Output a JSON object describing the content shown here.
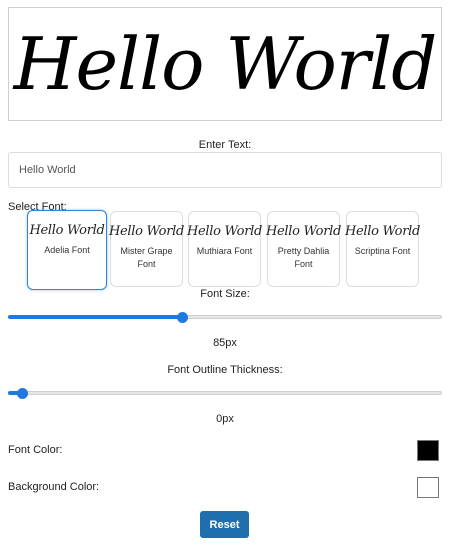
{
  "preview": {
    "text": "Hello World"
  },
  "text_input": {
    "label": "Enter Text:",
    "value": "Hello World"
  },
  "font_select": {
    "label": "Select Font:",
    "selected_index": 0,
    "options": [
      {
        "sample": "Hello World",
        "name": "Adelia Font"
      },
      {
        "sample": "Hello World",
        "name": "Mister Grape Font"
      },
      {
        "sample": "Hello World",
        "name": "Muthiara Font"
      },
      {
        "sample": "Hello World",
        "name": "Pretty Dahlia Font"
      },
      {
        "sample": "Hello World",
        "name": "Scriptina Font"
      }
    ]
  },
  "font_size": {
    "label": "Font Size:",
    "value_text": "85px",
    "level": 0.4
  },
  "outline": {
    "label": "Font Outline Thickness:",
    "value_text": "0px",
    "level": 0.0
  },
  "font_color": {
    "label": "Font Color:",
    "color": "#000000"
  },
  "background_color": {
    "label": "Background Color:",
    "color": "#ffffff"
  },
  "reset": {
    "label": "Reset"
  },
  "colors": {
    "accent": "#1f7ae0",
    "button": "#1f6fae"
  }
}
